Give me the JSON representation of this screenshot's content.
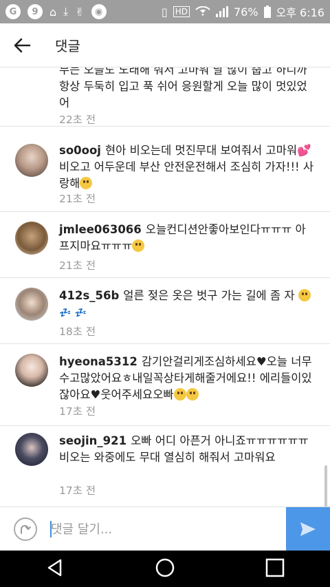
{
  "status": {
    "battery": "76%",
    "time": "오후 6:16",
    "left_icons": [
      "circle-g-icon",
      "circle-9-icon",
      "launcher-icon",
      "download-icon",
      "victory-icon",
      "app-icon"
    ],
    "right_icons": [
      "vibrate-icon",
      "hd-icon",
      "wifi-icon",
      "signal-icon",
      "battery-icon"
    ]
  },
  "header": {
    "title": "댓글"
  },
  "comments": [
    {
      "username": "",
      "text": "무는 오늘도 노래해 줘서 고마워 날 많이 춥고 하니까 항상 두둑히 입고 푹 쉬어 응원할게 오늘 많이 멋있었어",
      "time": "22초 전"
    },
    {
      "username": "so0ooj",
      "text": "현아 비오는데 멋진무대 보여줘서 고마워",
      "text2": " 비오고 어두운데 부산 안전운전해서 조심히 가자!!! 사랑해",
      "time": "21초 전"
    },
    {
      "username": "jmlee063066",
      "text": "오늘컨디션안좋아보인다ㅠㅠㅠ 아프지마요ㅠㅠㅠ",
      "time": "21초 전"
    },
    {
      "username": "412s_56b",
      "text": "얼른 젖은 옷은 벗구 가는 길에 좀 자",
      "zz": "💤",
      "time": "18초 전"
    },
    {
      "username": "hyeona5312",
      "text": "감기안걸리게조심하세요♥오늘 너무수고많았어요ㅎ내일꼭상타게해줄거에요!! 에리들이있잖아요♥웃어주세요오빠",
      "time": "17초 전"
    },
    {
      "username": "seojin_921",
      "text": "오빠 어디 아픈거 아니죠ㅠㅠㅠㅠㅠㅠ 비오는 와중에도 무대 열심히 해줘서 고마워요",
      "time": "17초 전"
    }
  ],
  "input": {
    "placeholder": "댓글 달기..."
  },
  "nav": [
    "back-icon",
    "home-icon",
    "recents-icon"
  ]
}
